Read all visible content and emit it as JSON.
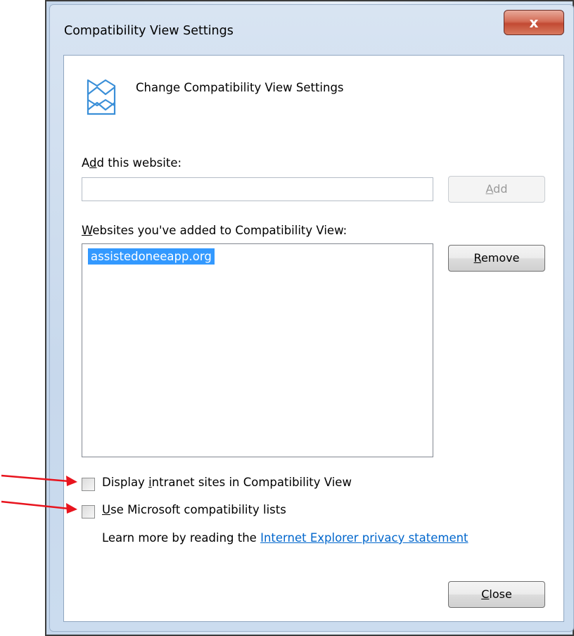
{
  "window": {
    "title": "Compatibility View Settings",
    "close_glyph": "x"
  },
  "header": {
    "icon": "compatibility-view-icon",
    "text": "Change Compatibility View Settings"
  },
  "add_section": {
    "label_pre": "A",
    "label_key": "d",
    "label_post": "d this website:",
    "input_value": "",
    "add_button_key": "A",
    "add_button_rest": "dd",
    "add_button_enabled": false
  },
  "list_section": {
    "label_key": "W",
    "label_post": "ebsites you've added to Compatibility View:",
    "sites": [
      "assistedoneeapp.org"
    ],
    "selected_index": 0,
    "remove_button_key": "R",
    "remove_button_rest": "emove"
  },
  "options": {
    "intranet": {
      "label_pre": "Display ",
      "label_key": "i",
      "label_post": "ntranet sites in Compatibility View",
      "checked": false
    },
    "ms_lists": {
      "label_key": "U",
      "label_post": "se Microsoft compatibility lists",
      "checked": false
    }
  },
  "learn_more": {
    "text": "Learn more by reading the ",
    "link": "Internet Explorer privacy statement"
  },
  "close_button": {
    "key": "C",
    "rest": "lose"
  },
  "annotations": {
    "arrow_color": "#e8141e"
  },
  "colors": {
    "selection": "#3399ff",
    "link": "#0066cc",
    "title_close_button": "#c24a33"
  }
}
